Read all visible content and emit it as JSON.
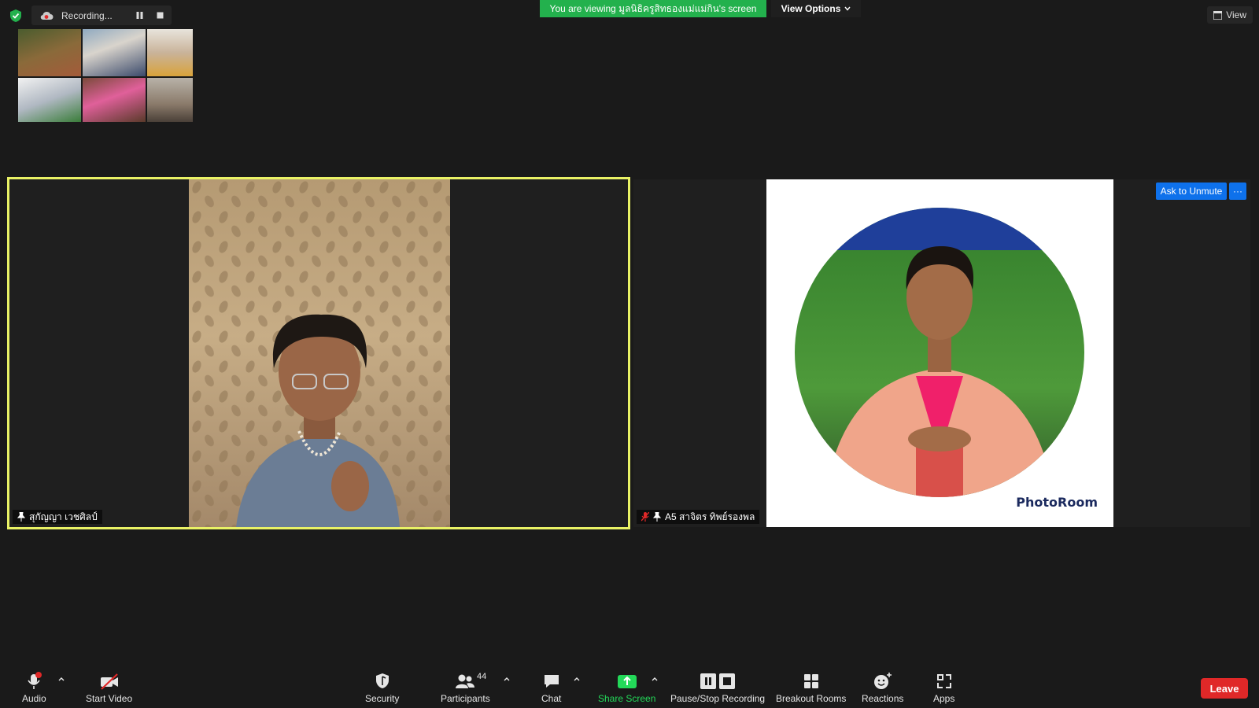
{
  "recording": {
    "label": "Recording...",
    "icon": "cloud-recording-icon"
  },
  "banner": {
    "text": "You are viewing มูลนิธิครูสิทธองแม่แม่กิน's screen",
    "color": "#23b14d"
  },
  "view_options": {
    "label": "View Options"
  },
  "view": {
    "label": "View"
  },
  "participants_tiles": [
    {
      "name": "สุกัญญา เวชศิลป์",
      "active_speaker": true
    },
    {
      "name": "A5 สาจิตร  ทิพย์รองพล",
      "muted": true
    }
  ],
  "ask_unmute": {
    "label": "Ask to Unmute"
  },
  "more": {
    "label": "···"
  },
  "photoroom": {
    "watermark": "PhotoRoom"
  },
  "toolbar": {
    "audio": {
      "label": "Audio",
      "icon": "microphone-icon",
      "alert": "!"
    },
    "start_video": {
      "label": "Start Video",
      "icon": "video-off-icon"
    },
    "security": {
      "label": "Security",
      "icon": "shield-icon"
    },
    "participants": {
      "label": "Participants",
      "icon": "people-icon",
      "count": "44"
    },
    "chat": {
      "label": "Chat",
      "icon": "chat-icon"
    },
    "share_screen": {
      "label": "Share Screen",
      "icon": "share-screen-icon"
    },
    "pause_stop_recording": {
      "label": "Pause/Stop Recording",
      "icon": "pause-stop-icon"
    },
    "breakout_rooms": {
      "label": "Breakout Rooms",
      "icon": "grid-icon"
    },
    "reactions": {
      "label": "Reactions",
      "icon": "smiley-icon"
    },
    "apps": {
      "label": "Apps",
      "icon": "apps-icon"
    },
    "leave": {
      "label": "Leave"
    }
  },
  "colors": {
    "accent_blue": "#0e71eb",
    "leave_red": "#e02828",
    "speaker_border": "#e9f265",
    "share_green": "#23d959"
  }
}
